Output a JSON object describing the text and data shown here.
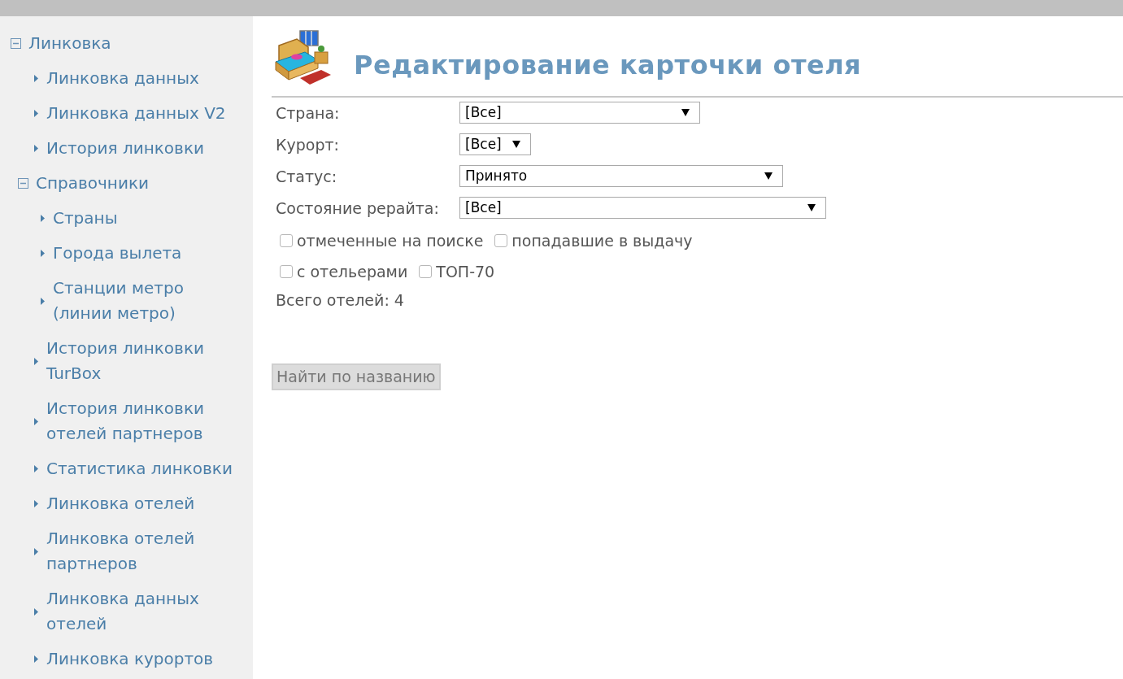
{
  "sidebar": {
    "items": [
      {
        "label": "Линковка",
        "expanded": true,
        "children": [
          {
            "label": "Линковка данных"
          },
          {
            "label": "Линковка данных V2"
          },
          {
            "label": "История линковки"
          },
          {
            "label": "Справочники",
            "expanded": true,
            "children": [
              {
                "label": "Страны"
              },
              {
                "label": "Города вылета"
              },
              {
                "label": "Станции метро (линии метро)"
              }
            ]
          },
          {
            "label": "История линковки TurBox"
          },
          {
            "label": "История линковки отелей партнеров"
          },
          {
            "label": "Статистика линковки"
          },
          {
            "label": "Линковка отелей"
          },
          {
            "label": "Линковка отелей партнеров"
          },
          {
            "label": "Линковка данных отелей"
          },
          {
            "label": "Линковка курортов"
          }
        ]
      }
    ]
  },
  "page": {
    "title": "Редактирование карточки отеля"
  },
  "filters": [
    {
      "label": "Страна:",
      "value": "[Все]"
    },
    {
      "label": "Курорт:",
      "value": "[Все]"
    },
    {
      "label": "Статус:",
      "value": "Принято"
    },
    {
      "label": "Состояние рерайта:",
      "value": "[Все]"
    }
  ],
  "checkbox_rows": [
    [
      {
        "label": "отмеченные на поиске",
        "checked": false
      },
      {
        "label": "попадавшие в выдачу",
        "checked": false
      }
    ],
    [
      {
        "label": "с отельерами",
        "checked": false
      },
      {
        "label": "ТОП-70",
        "checked": false
      }
    ]
  ],
  "total": "Всего отелей: 4",
  "search_button": {
    "label": "Найти по названию",
    "disabled": true
  }
}
